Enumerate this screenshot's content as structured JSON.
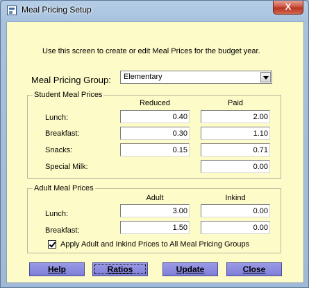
{
  "window": {
    "title": "Meal Pricing Setup",
    "close_glyph": "X"
  },
  "intro": "Use this screen to create or edit Meal Prices for the budget year.",
  "pricing_group": {
    "label": "Meal Pricing Group:",
    "selected": "Elementary"
  },
  "student": {
    "legend": "Student Meal Prices",
    "col_reduced": "Reduced",
    "col_paid": "Paid",
    "rows": [
      {
        "label": "Lunch:",
        "reduced": "0.40",
        "paid": "2.00"
      },
      {
        "label": "Breakfast:",
        "reduced": "0.30",
        "paid": "1.10"
      },
      {
        "label": "Snacks:",
        "reduced": "0.15",
        "paid": "0.71"
      },
      {
        "label": "Special Milk:",
        "reduced": null,
        "paid": "0.00"
      }
    ]
  },
  "adult": {
    "legend": "Adult Meal Prices",
    "col_adult": "Adult",
    "col_inkind": "Inkind",
    "rows": [
      {
        "label": "Lunch:",
        "adult": "3.00",
        "inkind": "0.00"
      },
      {
        "label": "Breakfast:",
        "adult": "1.50",
        "inkind": "0.00"
      }
    ],
    "apply_all_label": "Apply Adult and Inkind Prices to All Meal Pricing Groups",
    "apply_all_checked": true
  },
  "buttons": {
    "help": "Help",
    "ratios": "Ratios",
    "update": "Update",
    "close": "Close"
  },
  "colors": {
    "client_bg": "#fdfbc7",
    "button_bg": "#8c8ce0",
    "close_btn": "#c7503a"
  }
}
